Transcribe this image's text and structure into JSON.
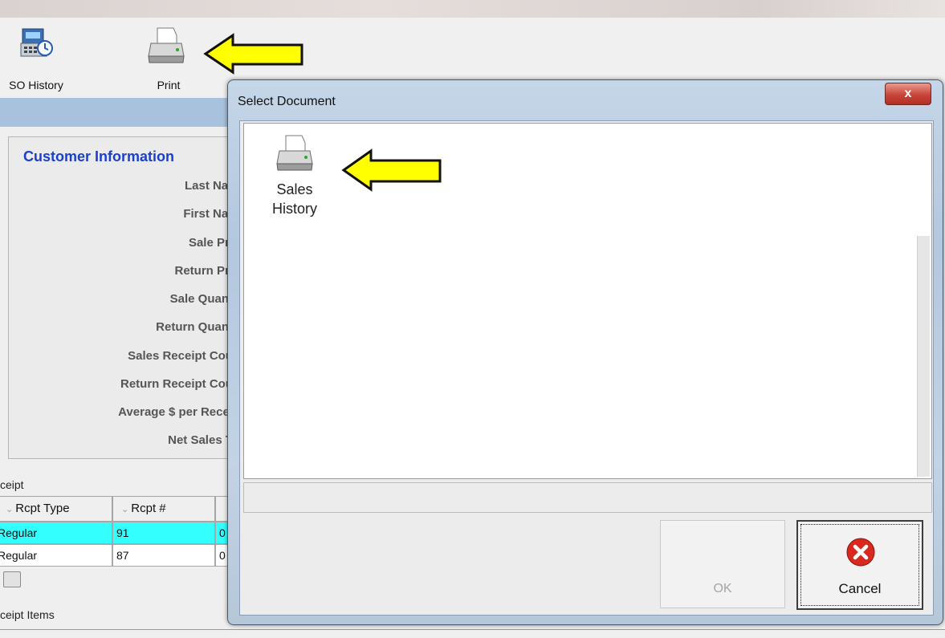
{
  "toolbar": {
    "buttons": [
      {
        "label": "SO History",
        "icon": "cash-register-icon"
      },
      {
        "label": "Print",
        "icon": "printer-icon"
      }
    ]
  },
  "customer_info": {
    "title": "Customer Information",
    "fields": [
      "Last Nar",
      "First Nar",
      "Sale Pri",
      "Return Pri",
      "Sale Quant",
      "Return Quant",
      "Sales Receipt Cou",
      "Return Receipt Cou",
      "Average $ per Recei",
      "Net Sales T"
    ]
  },
  "receipt": {
    "section_label": "ceipt",
    "columns": [
      "Rcpt Type",
      "Rcpt #"
    ],
    "rows": [
      {
        "type": "Regular",
        "num": "91",
        "extra": "0"
      },
      {
        "type": "Regular",
        "num": "87",
        "extra": "0"
      }
    ]
  },
  "receipt_items": {
    "section_label": "ceipt Items"
  },
  "dialog": {
    "title": "Select Document",
    "close_label": "x",
    "documents": [
      {
        "line1": "Sales",
        "line2": "History",
        "icon": "printer-icon"
      }
    ],
    "ok_label": "OK",
    "cancel_label": "Cancel"
  },
  "colors": {
    "selected_row": "#33ffff",
    "title_blue": "#1a3fd1",
    "arrow_yellow": "#ffff00"
  }
}
